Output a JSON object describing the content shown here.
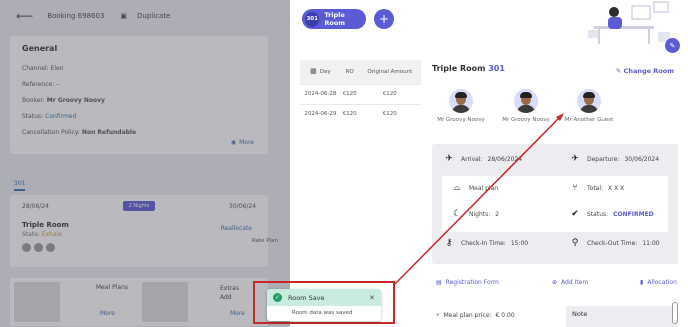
{
  "background": {
    "booking_label": "Booking 698603",
    "duplicate_label": "Duplicate",
    "general": {
      "title": "General",
      "channel": "Channel: Elen",
      "reference": "Reference: –",
      "booker_prefix": "Booker:",
      "booker_name": "Mr Groovy Noovy",
      "status_prefix": "Status:",
      "status_value": "Confirmed",
      "cancellation_prefix": "Cancellation Policy:",
      "cancellation_value": "Non Refundable",
      "more_label": "More"
    },
    "tab_label": "301",
    "stay": {
      "start_date": "28/06/24",
      "nights": "2 Nights",
      "end_date": "30/06/24",
      "room_title": "Triple Room",
      "state_prefix": "State:",
      "state_value": "Exhale",
      "reallocate_label": "Reallocate",
      "rate_plan": "Rate Plan"
    },
    "meal_plans_label": "Meal Plans",
    "meal_more_label": "More",
    "extras_label": "Extras",
    "extras_add": "Add",
    "extras_more_label": "More"
  },
  "panel": {
    "room_number": "301",
    "room_chip_label": "Triple Room",
    "add_symbol": "+",
    "price_table": {
      "headers": [
        "Day",
        "RO",
        "Original Amount"
      ],
      "rows": [
        [
          "2024-06-28",
          "€120",
          "€120"
        ],
        [
          "2024-06-29",
          "€120",
          "€120"
        ]
      ]
    },
    "room_title": "Triple Room",
    "change_room_label": "Change Room",
    "guests": [
      "Mr Groovy Noovy",
      "Mr Groovy Noovy",
      "Mr Another Guest"
    ],
    "arrival_label": "Arrival:",
    "arrival_value": "28/06/2024",
    "departure_label": "Departure:",
    "departure_value": "30/06/2024",
    "meal_plan_label": "Meal plan",
    "total_label": "Total:",
    "total_value": "X X X",
    "nights_label": "Nights:",
    "nights_value": "2",
    "status_label": "Status:",
    "status_value": "CONFIRMED",
    "checkin_label": "Check-In Time:",
    "checkin_value": "15:00",
    "checkout_label": "Check-Out Time:",
    "checkout_value": "11:00",
    "registration_label": "Registration Form",
    "add_item_label": "Add Item",
    "allocation_label": "Allocation",
    "meal_price_label": "Meal plan price:",
    "meal_price_value": "€ 0.00",
    "note_label": "Note"
  },
  "toast": {
    "title": "Room Save",
    "message": "Room data was saved",
    "close_symbol": "✕"
  },
  "colors": {
    "accent": "#5b5bd6",
    "success": "#1e9e62",
    "highlight": "#c62828"
  }
}
